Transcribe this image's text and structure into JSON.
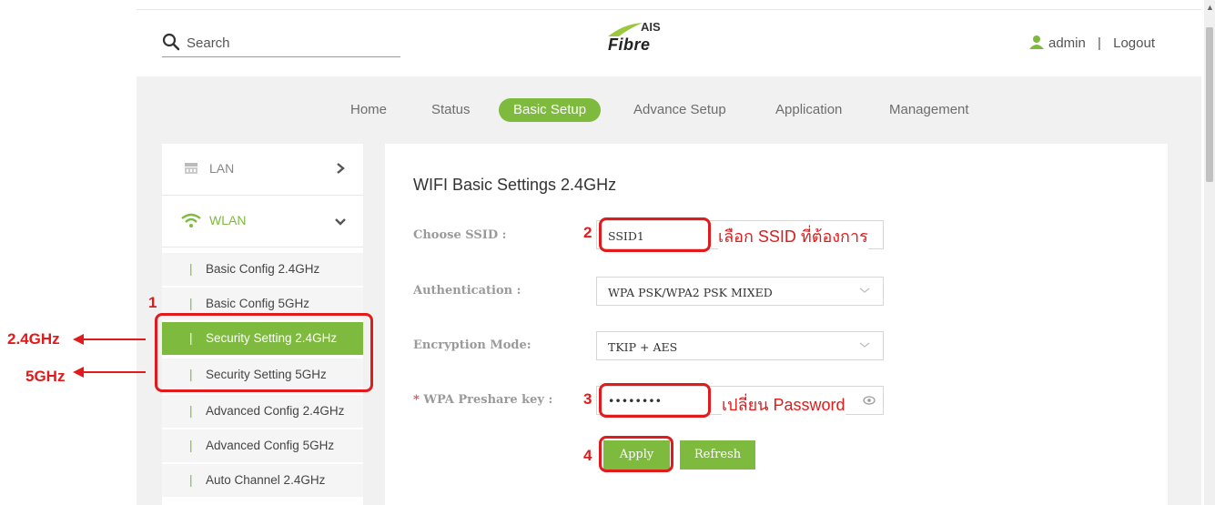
{
  "header": {
    "search_placeholder": "Search",
    "logo_top": "AIS",
    "logo_bottom": "Fibre",
    "user": "admin",
    "separator": "|",
    "logout": "Logout"
  },
  "nav": {
    "items": [
      "Home",
      "Status",
      "Basic Setup",
      "Advance Setup",
      "Application",
      "Management"
    ],
    "active": "Basic Setup"
  },
  "sidebar": {
    "lan": "LAN",
    "wlan": "WLAN",
    "submenu": [
      "Basic Config 2.4GHz",
      "Basic Config 5GHz",
      "Security Setting 2.4GHz",
      "Security Setting 5GHz",
      "Advanced Config 2.4GHz",
      "Advanced Config 5GHz",
      "Auto Channel 2.4GHz"
    ],
    "active_item": "Security Setting 2.4GHz"
  },
  "main": {
    "title": "WIFI Basic Settings 2.4GHz",
    "ssid_label": "Choose SSID :",
    "ssid_value": "SSID1",
    "auth_label": "Authentication :",
    "auth_value": "WPA PSK/WPA2 PSK MIXED",
    "enc_label": "Encryption Mode:",
    "enc_value": "TKIP + AES",
    "key_star": "*",
    "key_label": "WPA Preshare key :",
    "key_value": "••••••••",
    "apply": "Apply",
    "refresh": "Refresh"
  },
  "annotations": {
    "n1": "1",
    "n2": "2",
    "n3": "3",
    "n4": "4",
    "note_ssid": "เลือก SSID ที่ต้องการ",
    "note_password": "เปลี่ยน Password",
    "label_24": "2.4GHz",
    "label_5": "5GHz"
  },
  "colors": {
    "accent": "#7dba3e",
    "annotation": "#e11b1b",
    "background": "#f1f1f1"
  }
}
